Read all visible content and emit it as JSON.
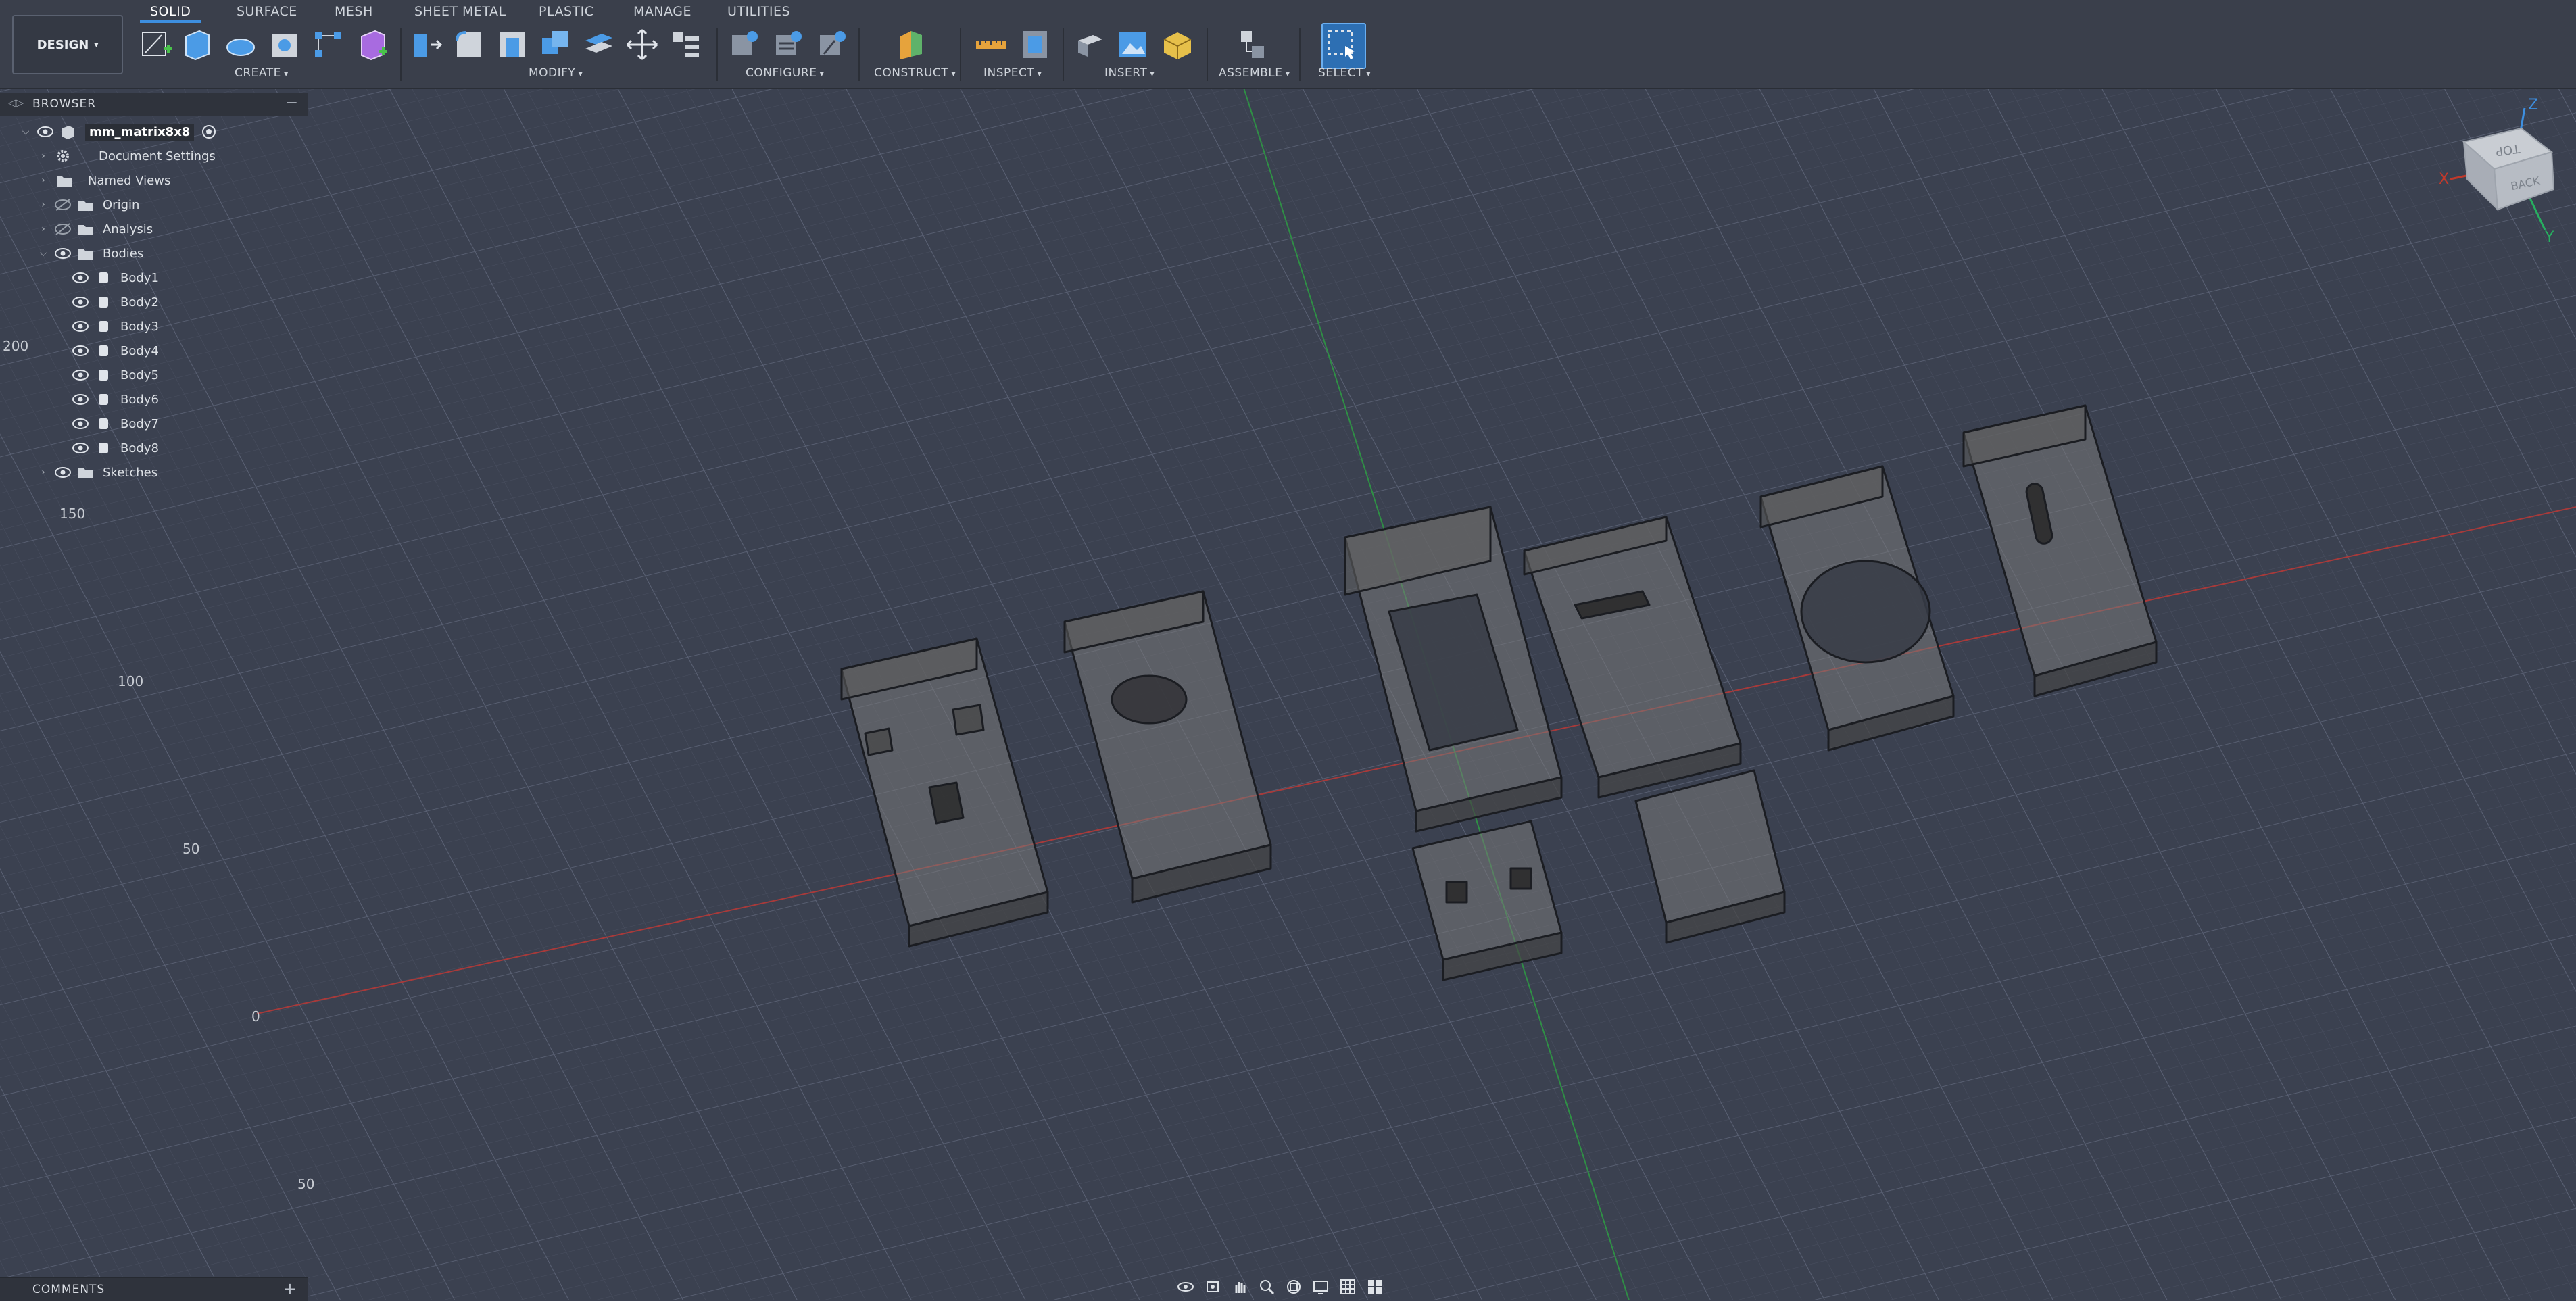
{
  "toolbar": {
    "workspace_label": "DESIGN",
    "tabs": [
      "SOLID",
      "SURFACE",
      "MESH",
      "SHEET METAL",
      "PLASTIC",
      "MANAGE",
      "UTILITIES"
    ],
    "groups": [
      "CREATE",
      "MODIFY",
      "CONFIGURE",
      "CONSTRUCT",
      "INSPECT",
      "INSERT",
      "ASSEMBLE",
      "SELECT"
    ]
  },
  "browser": {
    "title": "BROWSER",
    "root": "mm_matrix8x8",
    "folders": [
      "Document Settings",
      "Named Views",
      "Origin",
      "Analysis",
      "Bodies",
      "Sketches"
    ],
    "bodies": [
      "Body1",
      "Body2",
      "Body3",
      "Body4",
      "Body5",
      "Body6",
      "Body7",
      "Body8"
    ]
  },
  "comments": {
    "title": "COMMENTS"
  },
  "grid_labels": [
    "200",
    "150",
    "100",
    "50",
    "0",
    "50"
  ],
  "viewcube": {
    "top": "TOP",
    "back": "BACK",
    "axis_x": "X",
    "axis_y": "Y",
    "axis_z": "Z"
  },
  "colors": {
    "background": "#3b4150",
    "toolbar": "#3a3f4b",
    "accent": "#3d8fe0",
    "x_axis": "#b03a3a",
    "y_axis": "#2f8f45"
  }
}
